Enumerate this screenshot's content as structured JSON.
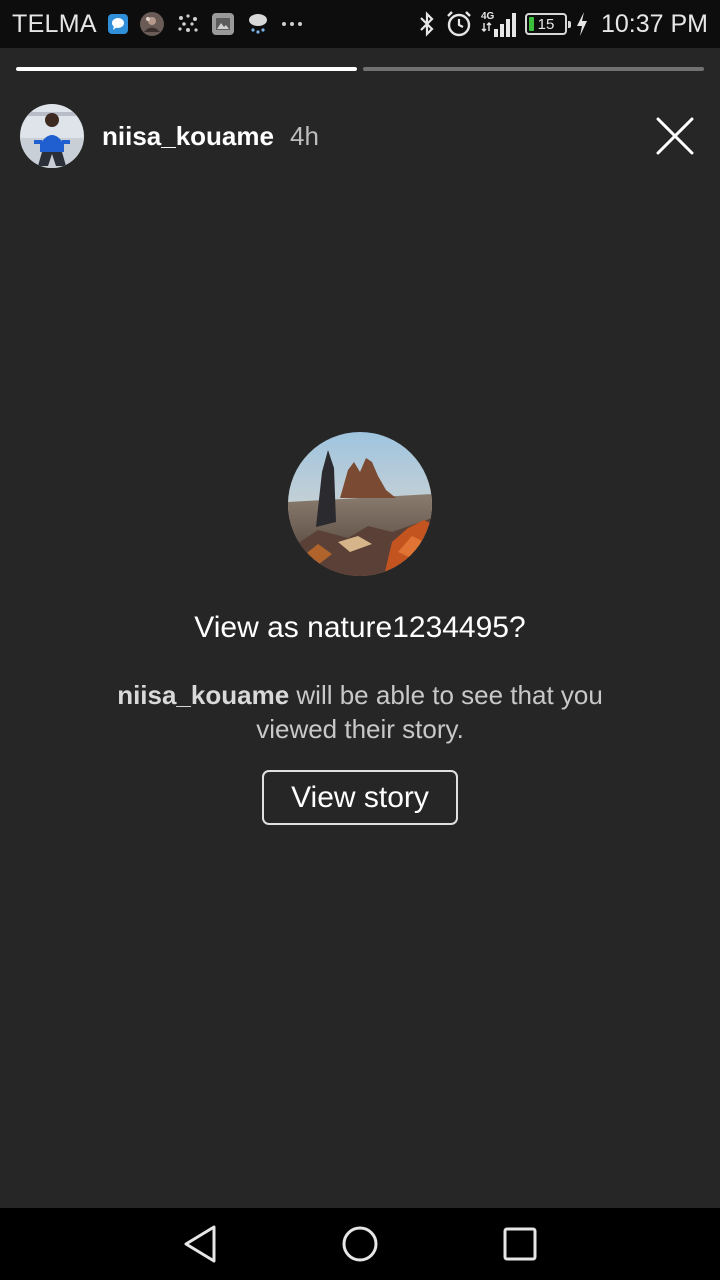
{
  "status_bar": {
    "carrier": "TELMA",
    "notification_icons": [
      "messenger-icon",
      "profile-photo-icon",
      "app-icon",
      "gallery-icon",
      "weather-rain-icon",
      "more-dots-icon"
    ],
    "network_label": "4G",
    "battery_level": "15",
    "battery_fraction": 0.15,
    "time": "10:37 PM"
  },
  "story_progress": {
    "segments": 2,
    "current_segment": 1
  },
  "story_header": {
    "username": "niisa_kouame",
    "age": "4h"
  },
  "prompt": {
    "title": "View as nature1234495?",
    "body_username": "niisa_kouame",
    "body_text": " will be able to see that you viewed their story.",
    "button_label": "View story"
  },
  "nav": {
    "icons": [
      "back-icon",
      "home-icon",
      "recents-icon"
    ]
  },
  "colors": {
    "background": "#262626",
    "status_bar": "#0d0d0d",
    "nav_bar": "#000000",
    "battery_green": "#3cbf3c"
  }
}
